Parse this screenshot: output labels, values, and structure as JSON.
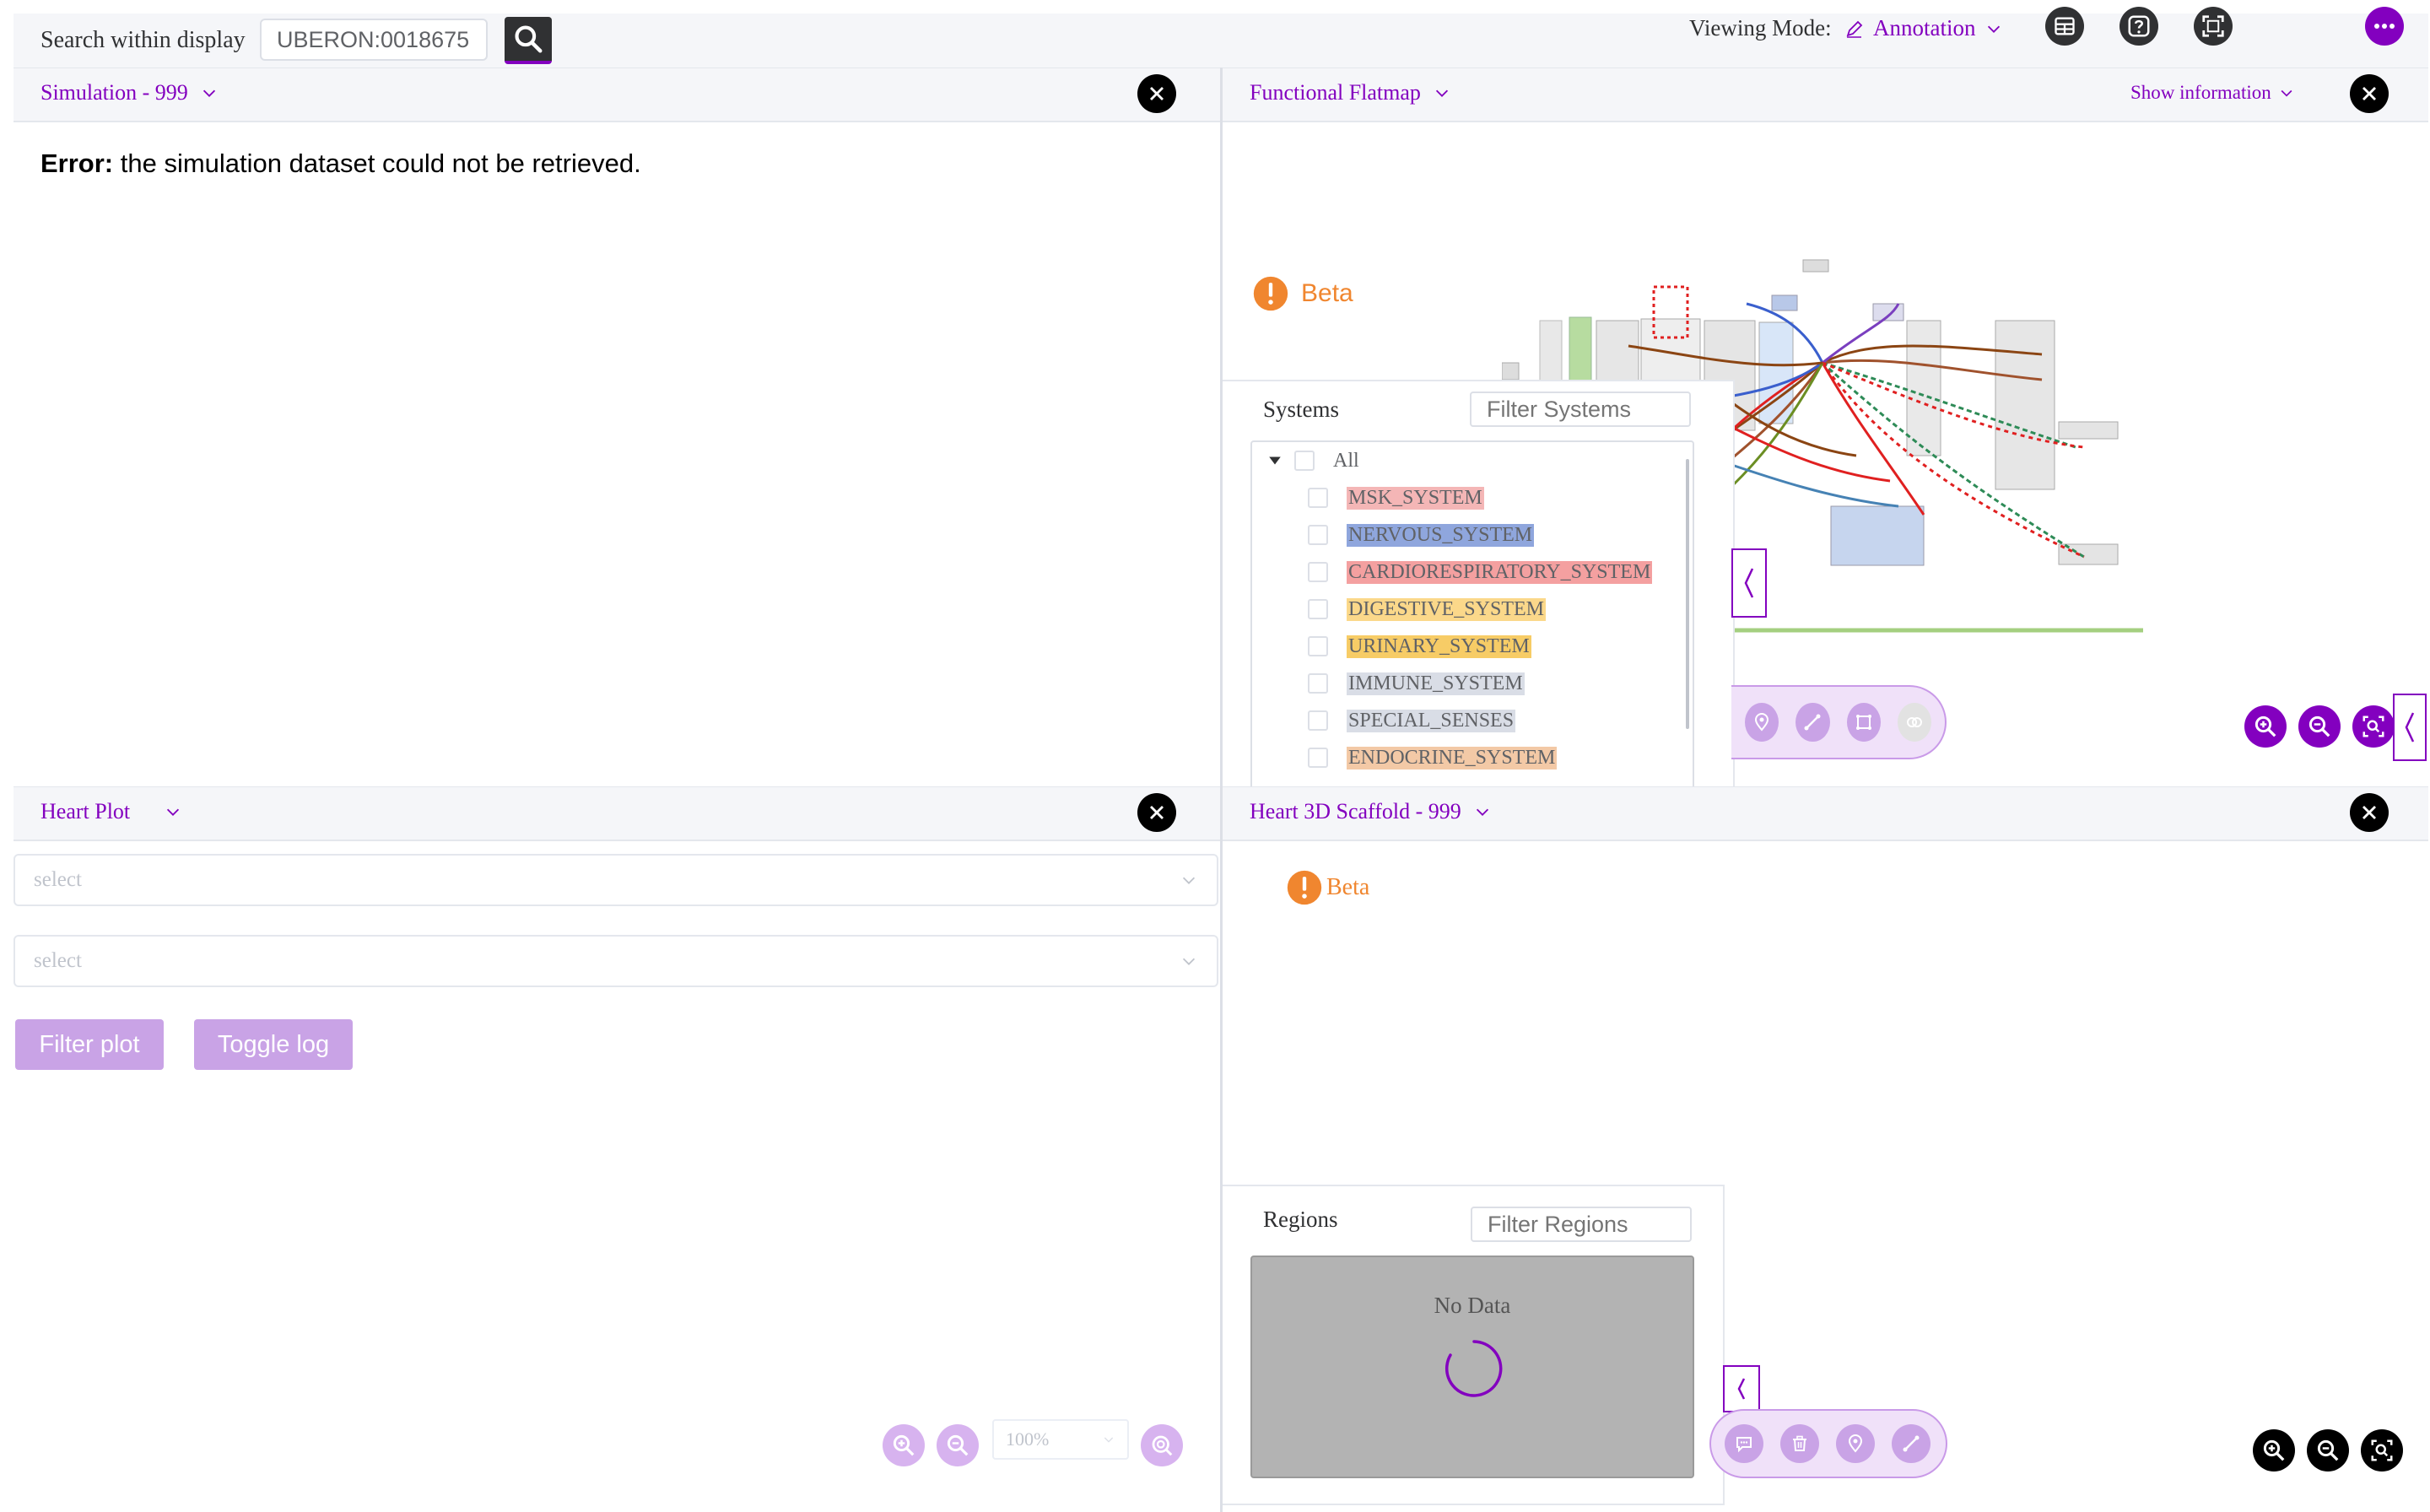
{
  "topbar": {
    "search_label": "Search within display",
    "search_value": "UBERON:0018675",
    "viewing_mode_label": "Viewing Mode:",
    "viewing_mode_value": "Annotation"
  },
  "panes": {
    "simulation": {
      "title": "Simulation - 999",
      "error_strong": "Error:",
      "error_text": "the simulation dataset could not be retrieved."
    },
    "flatmap": {
      "title": "Functional Flatmap",
      "show_info": "Show information",
      "beta": "Beta",
      "systems_title": "Systems",
      "filter_placeholder": "Filter Systems",
      "all_label": "All",
      "systems": [
        {
          "label": "MSK_SYSTEM",
          "color": "#f4b6b6"
        },
        {
          "label": "NERVOUS_SYSTEM",
          "color": "#8fa6dd"
        },
        {
          "label": "CARDIORESPIRATORY_SYSTEM",
          "color": "#f4a0a0"
        },
        {
          "label": "DIGESTIVE_SYSTEM",
          "color": "#fbd88a"
        },
        {
          "label": "URINARY_SYSTEM",
          "color": "#f7cc66"
        },
        {
          "label": "IMMUNE_SYSTEM",
          "color": "#d9dde6"
        },
        {
          "label": "SPECIAL_SENSES",
          "color": "#d9dde6"
        },
        {
          "label": "ENDOCRINE_SYSTEM",
          "color": "#f3c9a6"
        }
      ]
    },
    "heart_plot": {
      "title": "Heart Plot",
      "select1_placeholder": "select",
      "select2_placeholder": "select",
      "filter_button": "Filter plot",
      "toggle_button": "Toggle log",
      "zoom_value": "100%"
    },
    "scaffold": {
      "title": "Heart 3D Scaffold - 999",
      "beta": "Beta",
      "regions_title": "Regions",
      "filter_placeholder": "Filter Regions",
      "no_data": "No Data"
    }
  },
  "colors": {
    "accent": "#8300bf",
    "beta": "#f0862f"
  }
}
